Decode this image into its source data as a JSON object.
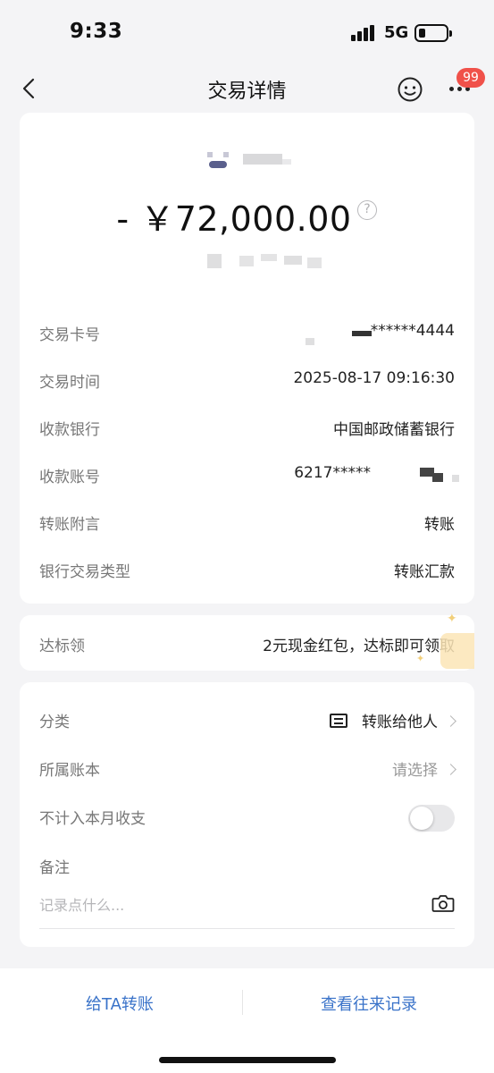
{
  "status_bar": {
    "time": "9:33",
    "network": "5G"
  },
  "nav": {
    "title": "交易详情",
    "badge_count": "99",
    "icons": [
      "back-icon",
      "smiley-service-icon",
      "more-icon"
    ]
  },
  "transaction": {
    "amount": "- ￥72,000.00",
    "help_symbol": "?",
    "rows": [
      {
        "label": "交易卡号",
        "value": "******4444"
      },
      {
        "label": "交易时间",
        "value": "2025-08-17 09:16:30"
      },
      {
        "label": "收款银行",
        "value": "中国邮政储蓄银行"
      },
      {
        "label": "收款账号",
        "value": "6217*****"
      },
      {
        "label": "转账附言",
        "value": "转账"
      },
      {
        "label": "银行交易类型",
        "value": "转账汇款"
      }
    ]
  },
  "reward": {
    "label": "达标领",
    "value": "2元现金红包，达标即可领取"
  },
  "meta": {
    "category_label": "分类",
    "category_value": "转账给他人",
    "account_label": "所属账本",
    "account_value": "请选择",
    "exclude_label": "不计入本月收支",
    "exclude_enabled": false,
    "note_label": "备注",
    "note_placeholder": "记录点什么..."
  },
  "bottom": {
    "transfer_label": "给TA转账",
    "history_label": "查看往来记录"
  },
  "colors": {
    "accent": "#3a73c9",
    "badge": "#f0514a",
    "background": "#f4f4f6"
  }
}
